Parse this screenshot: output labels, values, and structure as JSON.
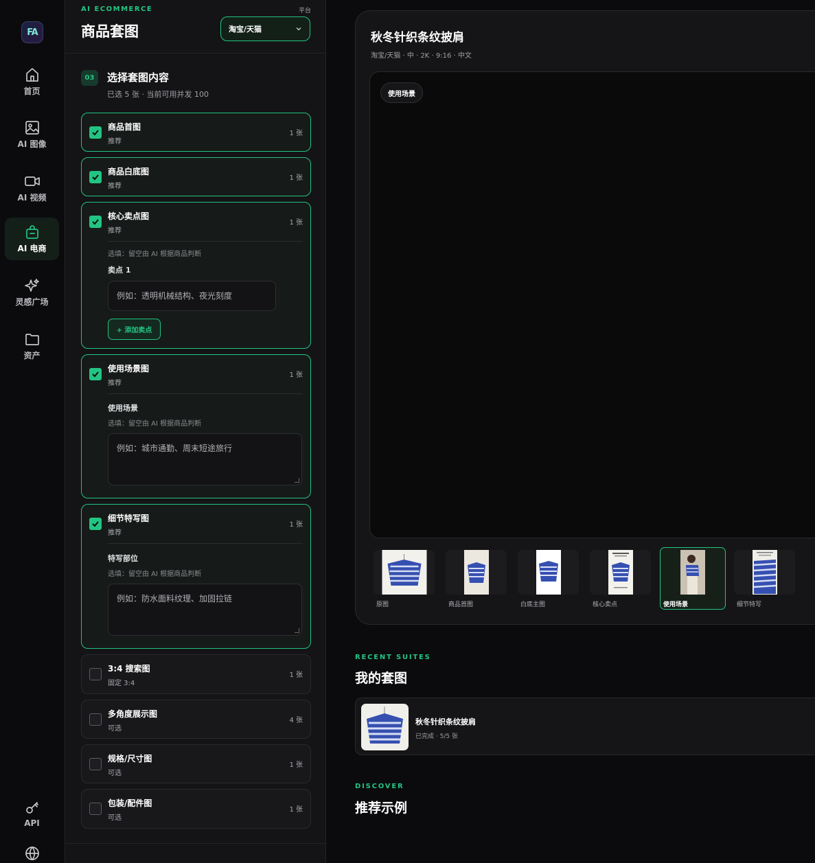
{
  "colors": {
    "accent": "#23c483",
    "background": "#0b0b0d",
    "panel": "#141416"
  },
  "sidebar": {
    "logo": "FA",
    "items": [
      {
        "label": "首页",
        "icon": "home-icon",
        "active": false
      },
      {
        "label": "AI 图像",
        "icon": "image-icon",
        "active": false
      },
      {
        "label": "AI 视频",
        "icon": "video-icon",
        "active": false
      },
      {
        "label": "AI 电商",
        "icon": "shopping-bag-icon",
        "active": true
      },
      {
        "label": "灵感广场",
        "icon": "sparkle-icon",
        "active": false
      },
      {
        "label": "资产",
        "icon": "folder-icon",
        "active": false
      }
    ],
    "api_label": "API",
    "globe_icon": "globe-icon"
  },
  "panel": {
    "eyebrow": "AI ECOMMERCE",
    "title": "商品套图",
    "platform_label": "平台",
    "platform_value": "淘宝/天猫",
    "step_number": "03",
    "step_title": "选择套图内容",
    "step_sub": "已选 5 张 · 当前可用并发 100",
    "cards": [
      {
        "name": "商品首图",
        "tag": "推荐",
        "count": "1 张",
        "checked": true
      },
      {
        "name": "商品白底图",
        "tag": "推荐",
        "count": "1 张",
        "checked": true
      },
      {
        "name": "核心卖点图",
        "tag": "推荐",
        "count": "1 张",
        "checked": true,
        "hint": "选填：留空由 AI 根据商品判断",
        "field_label": "卖点 1",
        "placeholder": "例如：透明机械结构、夜光刻度",
        "add_label": "+ 添加卖点"
      },
      {
        "name": "使用场景图",
        "tag": "推荐",
        "count": "1 张",
        "checked": true,
        "field_label": "使用场景",
        "hint": "选填：留空由 AI 根据商品判断",
        "placeholder": "例如：城市通勤、周末短途旅行"
      },
      {
        "name": "细节特写图",
        "tag": "推荐",
        "count": "1 张",
        "checked": true,
        "field_label": "特写部位",
        "hint": "选填：留空由 AI 根据商品判断",
        "placeholder": "例如：防水面料纹理、加固拉链"
      },
      {
        "name": "3:4 搜索图",
        "tag": "固定 3:4",
        "count": "1 张",
        "checked": false
      },
      {
        "name": "多角度展示图",
        "tag": "可选",
        "count": "4 张",
        "checked": false
      },
      {
        "name": "规格/尺寸图",
        "tag": "可选",
        "count": "1 张",
        "checked": false
      },
      {
        "name": "包装/配件图",
        "tag": "可选",
        "count": "1 张",
        "checked": false
      }
    ]
  },
  "preview": {
    "title": "秋冬针织条纹披肩",
    "meta": "淘宝/天猫 · 中 · 2K · 9:16 · 中文",
    "active_pill": "使用场景",
    "thumbs": [
      {
        "label": "原图",
        "active": false
      },
      {
        "label": "商品首图",
        "active": false
      },
      {
        "label": "白底主图",
        "active": false
      },
      {
        "label": "核心卖点",
        "active": false
      },
      {
        "label": "使用场景",
        "active": true
      },
      {
        "label": "细节特写",
        "active": false
      }
    ]
  },
  "recent": {
    "eyebrow": "RECENT SUITES",
    "title": "我的套图",
    "suite_name": "秋冬针织条纹披肩",
    "suite_status": "已完成 · 5/5 张"
  },
  "discover": {
    "eyebrow": "DISCOVER",
    "title": "推荐示例"
  }
}
